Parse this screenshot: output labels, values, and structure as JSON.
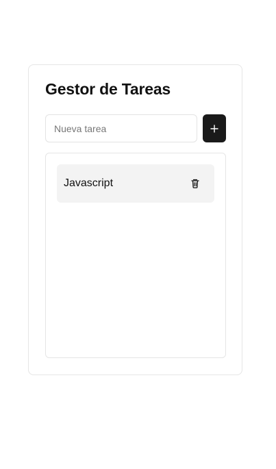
{
  "app": {
    "title": "Gestor de Tareas"
  },
  "input": {
    "value": "",
    "placeholder": "Nueva tarea"
  },
  "buttons": {
    "add_icon": "plus-icon",
    "delete_icon": "trash-icon"
  },
  "tasks": [
    {
      "label": "Javascript"
    }
  ],
  "colors": {
    "accent": "#1a1a1a",
    "item_background": "#f3f3f3",
    "border": "#e5e5e5"
  }
}
